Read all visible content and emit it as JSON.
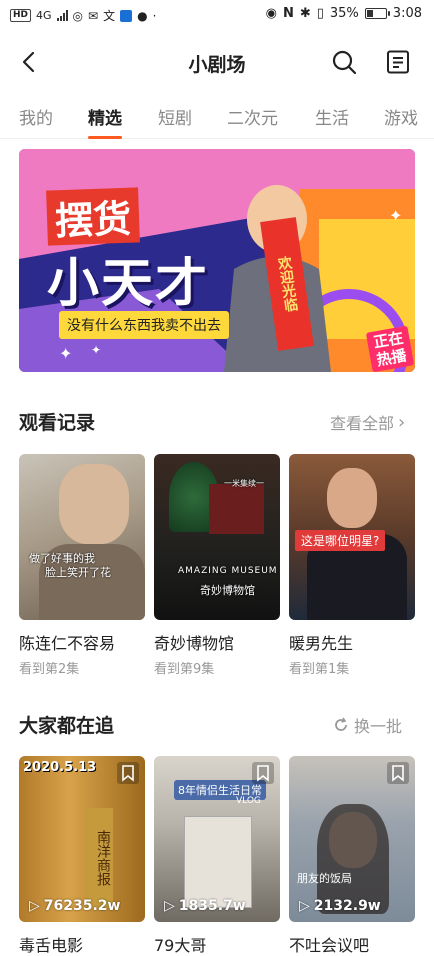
{
  "status_bar": {
    "hd": "HD",
    "net": "4G",
    "battery_pct": "35%",
    "time": "3:08",
    "battery_level": 0.35
  },
  "header": {
    "title": "小剧场"
  },
  "tabs": [
    {
      "label": "我的"
    },
    {
      "label": "精选"
    },
    {
      "label": "短剧"
    },
    {
      "label": "二次元"
    },
    {
      "label": "生活"
    },
    {
      "label": "游戏"
    }
  ],
  "active_tab_index": 1,
  "banner": {
    "line1": "摆货",
    "line2": "小天才",
    "subtitle": "没有什么东西我卖不出去",
    "sash": "欢迎光临",
    "live_tag_line1": "正在",
    "live_tag_line2": "热播",
    "colors": {
      "bg": "#2c2a8c",
      "pink": "#f07ac2",
      "yellow": "#ffd93c",
      "orange": "#ff8a2b"
    }
  },
  "watch_history": {
    "title": "观看记录",
    "view_all": "查看全部",
    "items": [
      {
        "name": "陈连仁不容易",
        "progress": "看到第2集",
        "overlay_1": "做了好事的我",
        "overlay_2": "脸上笑开了花"
      },
      {
        "name": "奇妙博物馆",
        "progress": "看到第9集",
        "overlay_1": "AMAZING MUSEUM",
        "overlay_2": "奇妙博物馆",
        "overlay_3": "一米集续一"
      },
      {
        "name": "暖男先生",
        "progress": "看到第1集",
        "overlay_1": "这是哪位明星?"
      }
    ]
  },
  "trending": {
    "title": "大家都在追",
    "refresh": "换一批",
    "items": [
      {
        "name": "毒舌电影",
        "views": "76235.2w",
        "overlay": "2020.5.13",
        "overlay_2": "南洋商报"
      },
      {
        "name": "79大哥",
        "views": "1835.7w",
        "overlay": "8年情侣生活日常",
        "overlay_2": "VLOG"
      },
      {
        "name": "不吐会议吧",
        "views": "2132.9w",
        "overlay": "朋友的饭局"
      }
    ]
  },
  "accent_color": "#ff5a1f"
}
